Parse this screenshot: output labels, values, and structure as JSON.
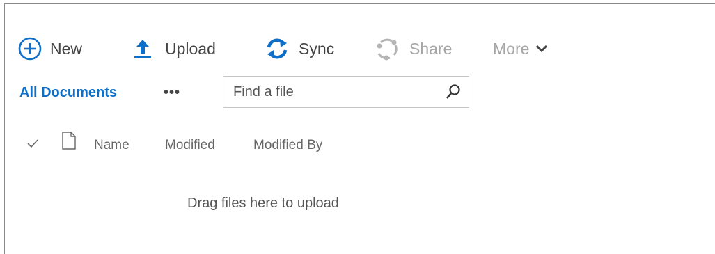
{
  "toolbar": {
    "new_label": "New",
    "upload_label": "Upload",
    "sync_label": "Sync",
    "share_label": "Share",
    "more_label": "More"
  },
  "icons": {
    "new": "plus-circle-icon",
    "upload": "upload-arrow-icon",
    "sync": "sync-icon",
    "share": "share-icon",
    "more": "chevron-down-icon",
    "search": "search-icon",
    "check": "check-icon",
    "file_type": "document-icon"
  },
  "views": {
    "current_label": "All Documents",
    "more_views": "•••"
  },
  "search": {
    "placeholder": "Find a file",
    "value": ""
  },
  "columns": [
    "Name",
    "Modified",
    "Modified By"
  ],
  "empty_message": "Drag files here to upload",
  "colors": {
    "accent": "#0f6fc6",
    "text": "#444444",
    "disabled": "#a6a6a6",
    "border": "#c6c6c6"
  }
}
